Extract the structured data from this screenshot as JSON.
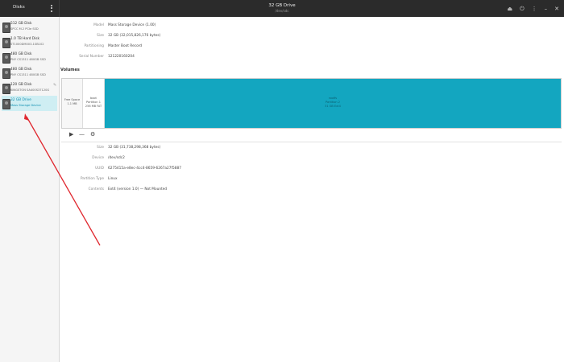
{
  "header": {
    "left_title": "Disks",
    "title": "32 GB Drive",
    "subtitle": "/dev/sdc",
    "icons": [
      "eject-icon",
      "power-icon",
      "menu-icon",
      "minimize-icon",
      "close-icon"
    ]
  },
  "sidebar": {
    "items": [
      {
        "name": "512 GB Disk",
        "sub": "SPCC M.2 PCIe SSD"
      },
      {
        "name": "1.0 TB Hard Disk",
        "sub": "ST1000DM003-1SB102"
      },
      {
        "name": "480 GB Disk",
        "sub": "PNY CS1311 480GB SSD"
      },
      {
        "name": "480 GB Disk",
        "sub": "PNY CS1311 480GB SSD"
      },
      {
        "name": "120 GB Disk",
        "sub": "KINGSTON SA400S37120G"
      },
      {
        "name": "32 GB Drive",
        "sub": "Mass Storage Device"
      }
    ]
  },
  "drive_info": [
    {
      "label": "Model",
      "value": "Mass Storage Device (1.00)"
    },
    {
      "label": "Size",
      "value": "32 GB (32,015,826,176 bytes)"
    },
    {
      "label": "Partitioning",
      "value": "Master Boot Record"
    },
    {
      "label": "Serial Number",
      "value": "121220160204"
    }
  ],
  "volumes": {
    "title": "Volumes",
    "segments": {
      "free": {
        "line1": "Free Space",
        "line2": "1.1 MB"
      },
      "p1": {
        "line1": "boot",
        "line2": "Partition 1",
        "line3": "256 MB FAT"
      },
      "p2": {
        "line1": "rootfs",
        "line2": "Partition 2",
        "line3": "31 GB Ext4"
      }
    },
    "tools": [
      "play-icon",
      "minus-icon",
      "gears-icon"
    ]
  },
  "partition_info": [
    {
      "label": "Size",
      "value": "32 GB (31,738,298,368 bytes)"
    },
    {
      "label": "Device",
      "value": "/dev/sdc2"
    },
    {
      "label": "UUID",
      "value": "6275415a-e8ec-4cc4-8659-6267a27f5887"
    },
    {
      "label": "Partition Type",
      "value": "Linux"
    },
    {
      "label": "Contents",
      "value": "Ext4 (version 1.0) — Not Mounted"
    }
  ]
}
